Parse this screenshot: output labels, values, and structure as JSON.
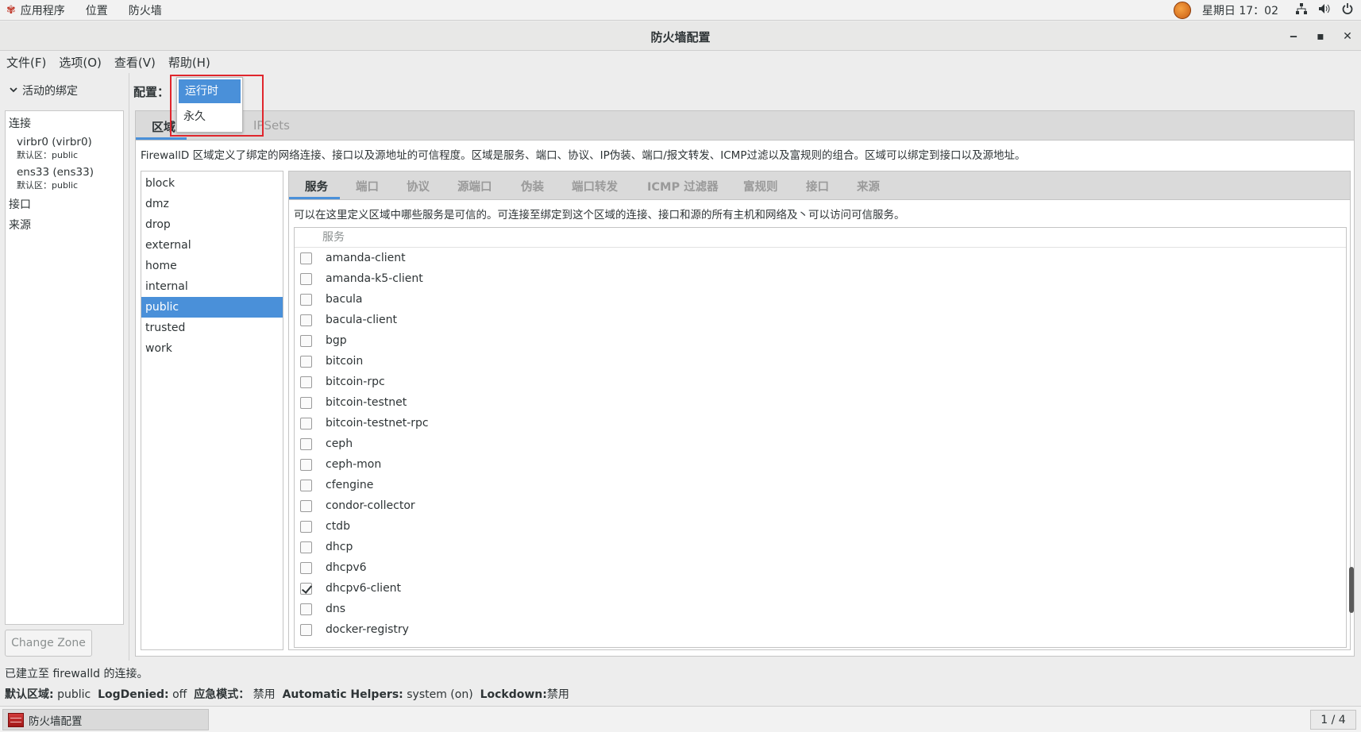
{
  "top_panel": {
    "menus": [
      "应用程序",
      "位置",
      "防火墙"
    ],
    "clock": "星期日 17：02"
  },
  "window": {
    "title": "防火墙配置",
    "buttons": [
      "‒",
      "▪",
      "✕"
    ]
  },
  "menubar": [
    "文件(F)",
    "选项(O)",
    "查看(V)",
    "帮助(H)"
  ],
  "left": {
    "header": "活动的绑定",
    "connections_label": "连接",
    "connections": [
      {
        "name": "virbr0 (virbr0)",
        "zone": "默认区：public"
      },
      {
        "name": "ens33 (ens33)",
        "zone": "默认区：public"
      }
    ],
    "interfaces_label": "接口",
    "sources_label": "来源",
    "change_zone": "Change Zone"
  },
  "config": {
    "label": "配置：",
    "options": [
      "运行时",
      "永久"
    ],
    "selected": "运行时"
  },
  "main_tabs": [
    "区域",
    "IPSets"
  ],
  "zone_description": "FirewallD 区域定义了绑定的网络连接、接口以及源地址的可信程度。区域是服务、端口、协议、IP伪装、端口/报文转发、ICMP过滤以及富规则的组合。区域可以绑定到接口以及源地址。",
  "zones": [
    "block",
    "dmz",
    "drop",
    "external",
    "home",
    "internal",
    "public",
    "trusted",
    "work"
  ],
  "selected_zone": "public",
  "service_tabs": [
    "服务",
    "端口",
    "协议",
    "源端口",
    "伪装",
    "端口转发",
    "ICMP 过滤器",
    "富规则",
    "接口",
    "来源"
  ],
  "service_description": "可以在这里定义区域中哪些服务是可信的。可连接至绑定到这个区域的连接、接口和源的所有主机和网络及丶可以访问可信服务。",
  "service_column": "服务",
  "services": [
    {
      "name": "amanda-client",
      "checked": false
    },
    {
      "name": "amanda-k5-client",
      "checked": false
    },
    {
      "name": "bacula",
      "checked": false
    },
    {
      "name": "bacula-client",
      "checked": false
    },
    {
      "name": "bgp",
      "checked": false
    },
    {
      "name": "bitcoin",
      "checked": false
    },
    {
      "name": "bitcoin-rpc",
      "checked": false
    },
    {
      "name": "bitcoin-testnet",
      "checked": false
    },
    {
      "name": "bitcoin-testnet-rpc",
      "checked": false
    },
    {
      "name": "ceph",
      "checked": false
    },
    {
      "name": "ceph-mon",
      "checked": false
    },
    {
      "name": "cfengine",
      "checked": false
    },
    {
      "name": "condor-collector",
      "checked": false
    },
    {
      "name": "ctdb",
      "checked": false
    },
    {
      "name": "dhcp",
      "checked": false
    },
    {
      "name": "dhcpv6",
      "checked": false
    },
    {
      "name": "dhcpv6-client",
      "checked": true
    },
    {
      "name": "dns",
      "checked": false
    },
    {
      "name": "docker-registry",
      "checked": false
    }
  ],
  "status": {
    "line1": "已建立至 firewalld 的连接。",
    "default_zone_label": "默认区域:",
    "default_zone": "public",
    "logdenied_label": "LogDenied:",
    "logdenied": "off",
    "panic_label": "应急模式：",
    "panic": "禁用",
    "helpers_label": "Automatic Helpers:",
    "helpers": "system (on)",
    "lockdown_label": "Lockdown:",
    "lockdown": "禁用"
  },
  "taskbar": {
    "item": "防火墙配置",
    "pager": "1 / 4"
  },
  "colors": {
    "accent": "#4a90d9",
    "highlight_box": "#e0262d"
  }
}
